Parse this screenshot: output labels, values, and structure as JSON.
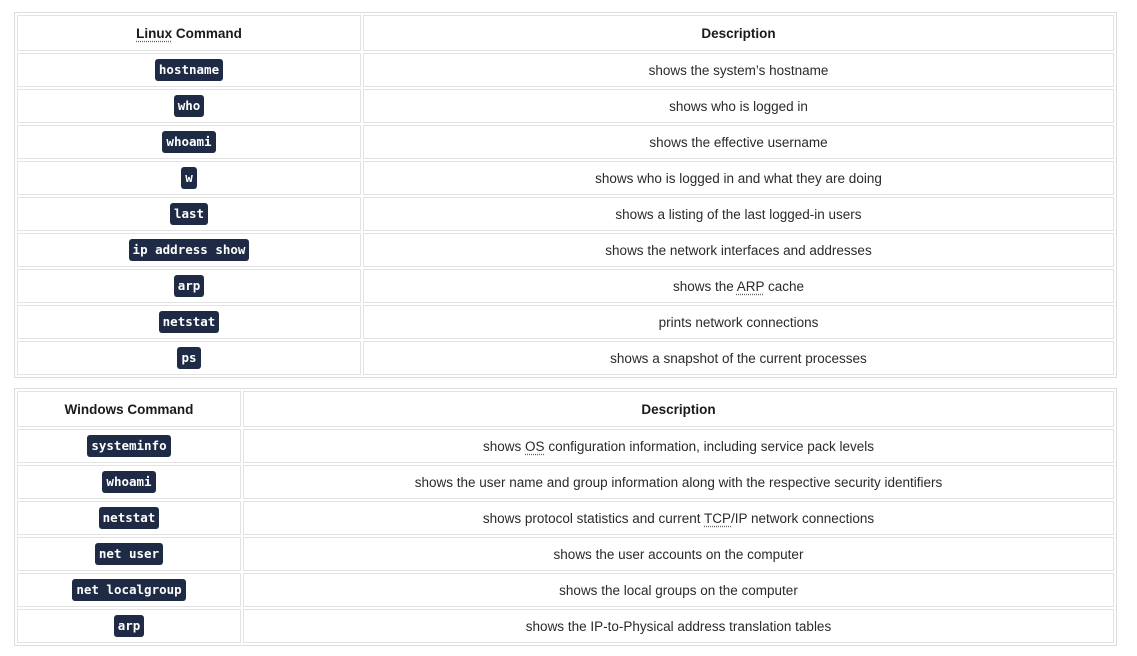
{
  "linux_table": {
    "header": {
      "command": "Linux Command",
      "description": "Description"
    },
    "rows": [
      {
        "command": "hostname",
        "description": "shows the system’s hostname"
      },
      {
        "command": "who",
        "description": "shows who is logged in"
      },
      {
        "command": "whoami",
        "description": "shows the effective username"
      },
      {
        "command": "w",
        "description": "shows who is logged in and what they are doing"
      },
      {
        "command": "last",
        "description": "shows a listing of the last logged-in users"
      },
      {
        "command": "ip address show",
        "description": "shows the network interfaces and addresses"
      },
      {
        "command": "arp",
        "description": "shows the ARP cache"
      },
      {
        "command": "netstat",
        "description": "prints network connections"
      },
      {
        "command": "ps",
        "description": "shows a snapshot of the current processes"
      }
    ]
  },
  "windows_table": {
    "header": {
      "command": "Windows Command",
      "description": "Description"
    },
    "rows": [
      {
        "command": "systeminfo",
        "description": "shows OS configuration information, including service pack levels"
      },
      {
        "command": "whoami",
        "description": "shows the user name and group information along with the respective security identifiers"
      },
      {
        "command": "netstat",
        "description": "shows protocol statistics and current TCP/IP network connections"
      },
      {
        "command": "net user",
        "description": "shows the user accounts on the computer"
      },
      {
        "command": "net localgroup",
        "description": "shows the local groups on the computer"
      },
      {
        "command": "arp",
        "description": "shows the IP-to-Physical address translation tables"
      }
    ]
  },
  "abbreviations": [
    "Linux",
    "ARP",
    "OS",
    "TCP"
  ],
  "colors": {
    "code_background": "#1f2a44",
    "code_text": "#ffffff",
    "cell_border": "#e3e3e3",
    "table_border": "#dddddd"
  }
}
